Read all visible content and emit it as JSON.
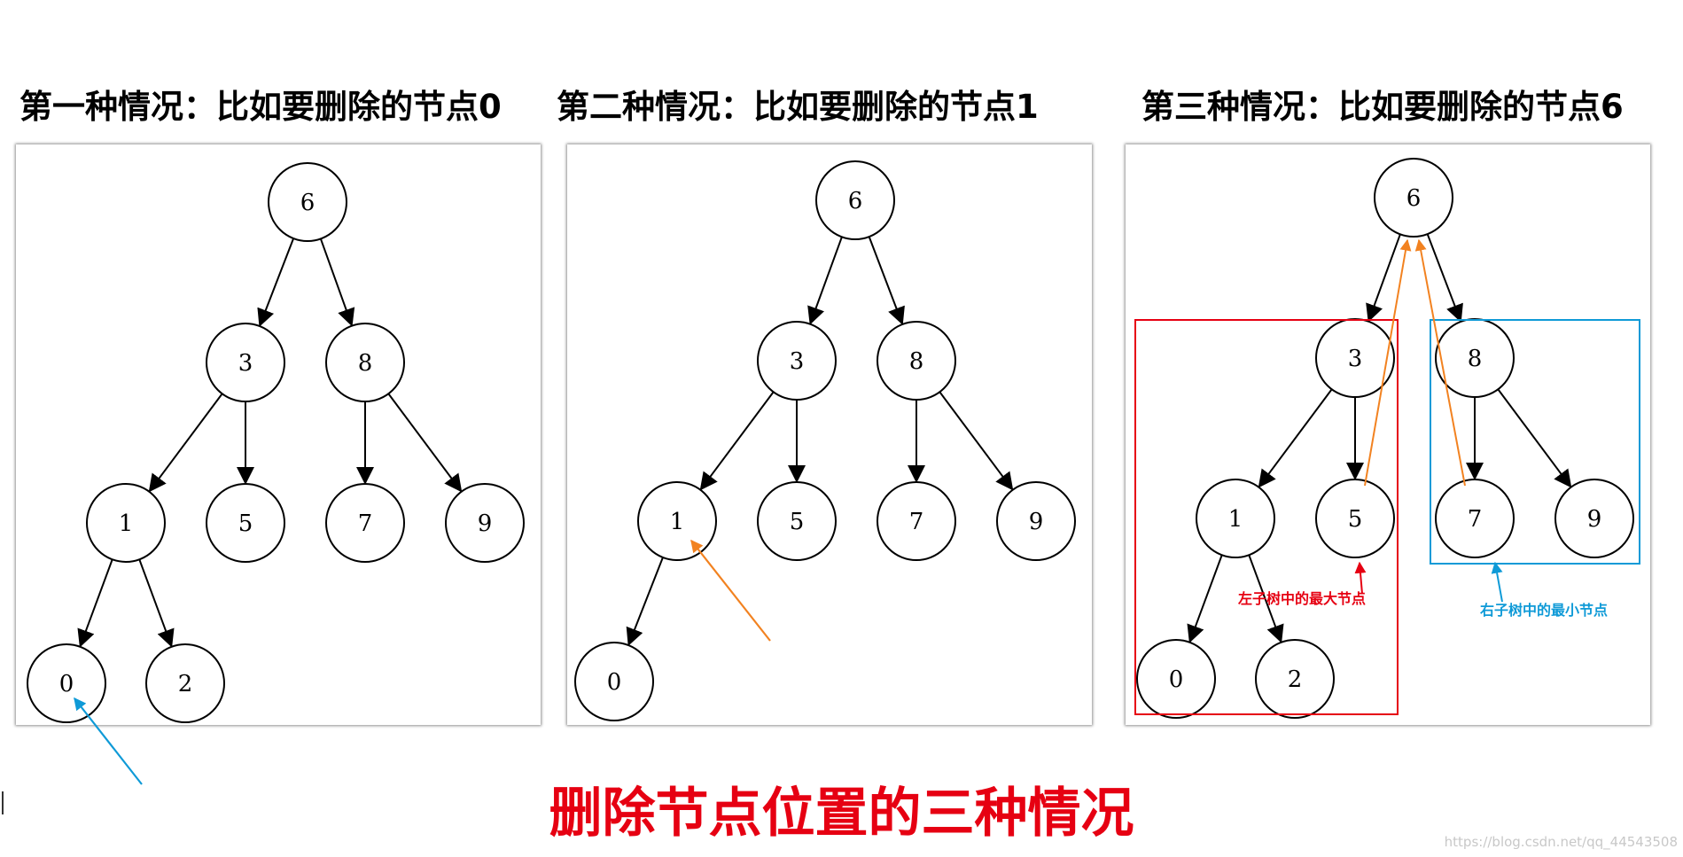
{
  "case_titles": [
    {
      "text": "第一种情况：比如要删除的节点0",
      "color": "#0f9ad7"
    },
    {
      "text": "第二种情况：比如要删除的节点1",
      "color": "#f28220"
    },
    {
      "text": "第三种情况：比如要删除的节点6",
      "color": "#e60012"
    }
  ],
  "trees": [
    {
      "nodes": [
        {
          "id": "6",
          "label": "6"
        },
        {
          "id": "3",
          "label": "3"
        },
        {
          "id": "8",
          "label": "8"
        },
        {
          "id": "1",
          "label": "1"
        },
        {
          "id": "5",
          "label": "5"
        },
        {
          "id": "7",
          "label": "7"
        },
        {
          "id": "9",
          "label": "9"
        },
        {
          "id": "0",
          "label": "0"
        },
        {
          "id": "2",
          "label": "2"
        }
      ],
      "edges": [
        [
          "6",
          "3"
        ],
        [
          "6",
          "8"
        ],
        [
          "3",
          "1"
        ],
        [
          "3",
          "5"
        ],
        [
          "8",
          "7"
        ],
        [
          "8",
          "9"
        ],
        [
          "1",
          "0"
        ],
        [
          "1",
          "2"
        ]
      ],
      "target_node": "0"
    },
    {
      "nodes": [
        {
          "id": "6",
          "label": "6"
        },
        {
          "id": "3",
          "label": "3"
        },
        {
          "id": "8",
          "label": "8"
        },
        {
          "id": "1",
          "label": "1"
        },
        {
          "id": "5",
          "label": "5"
        },
        {
          "id": "7",
          "label": "7"
        },
        {
          "id": "9",
          "label": "9"
        },
        {
          "id": "0",
          "label": "0"
        }
      ],
      "edges": [
        [
          "6",
          "3"
        ],
        [
          "6",
          "8"
        ],
        [
          "3",
          "1"
        ],
        [
          "3",
          "5"
        ],
        [
          "8",
          "7"
        ],
        [
          "8",
          "9"
        ],
        [
          "1",
          "0"
        ]
      ],
      "target_node": "1"
    },
    {
      "nodes": [
        {
          "id": "6",
          "label": "6"
        },
        {
          "id": "3",
          "label": "3"
        },
        {
          "id": "8",
          "label": "8"
        },
        {
          "id": "1",
          "label": "1"
        },
        {
          "id": "5",
          "label": "5"
        },
        {
          "id": "7",
          "label": "7"
        },
        {
          "id": "9",
          "label": "9"
        },
        {
          "id": "0",
          "label": "0"
        },
        {
          "id": "2",
          "label": "2"
        }
      ],
      "edges": [
        [
          "6",
          "3"
        ],
        [
          "6",
          "8"
        ],
        [
          "3",
          "1"
        ],
        [
          "3",
          "5"
        ],
        [
          "8",
          "7"
        ],
        [
          "8",
          "9"
        ],
        [
          "1",
          "0"
        ],
        [
          "1",
          "2"
        ]
      ],
      "target_node": "6",
      "annotations": {
        "left_subtree_label": "左子树中的最大节点",
        "right_subtree_label": "右子树中的最小节点",
        "left_color": "#e60012",
        "right_color": "#0f9ad7",
        "replacement_arrow_color": "#f28220"
      }
    }
  ],
  "main_caption": "删除节点位置的三种情况",
  "watermark": "https://blog.csdn.net/qq_44543508"
}
